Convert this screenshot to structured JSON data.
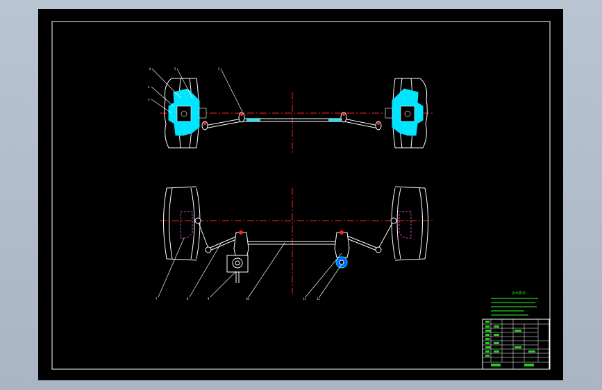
{
  "app": {
    "title": ""
  },
  "drawing": {
    "tech_requirements_title": "技术要求",
    "tech_requirements_lines": [
      "",
      "",
      "",
      "",
      ""
    ],
    "balloon_count_top": 6,
    "balloon_count_bottom": 6
  },
  "title_block": {
    "rows": 9,
    "footer_left": "",
    "footer_right": ""
  },
  "colors": {
    "background": "#b9c4d2",
    "sheet": "#000000",
    "frame": "#ffffff",
    "centerline": "#ff2020",
    "cyan_part": "#00e5ff",
    "hidden_magenta": "#d040d0",
    "title_text": "#20d020"
  }
}
